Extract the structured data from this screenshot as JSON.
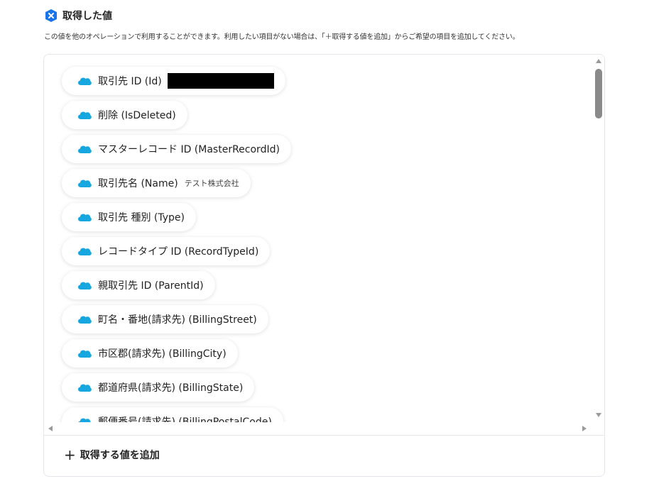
{
  "header": {
    "title": "取得した値"
  },
  "description": "この値を他のオペレーションで利用することができます。利用したい項目がない場合は、「＋取得する値を追加」からご希望の項目を追加してください。",
  "colors": {
    "brand_blue": "#1a73e8",
    "salesforce_cloud": "#16a6e0"
  },
  "items": [
    {
      "label": "取引先 ID (Id)",
      "value": "",
      "redacted": true
    },
    {
      "label": "削除 (IsDeleted)",
      "value": ""
    },
    {
      "label": "マスターレコード ID (MasterRecordId)",
      "value": ""
    },
    {
      "label": "取引先名 (Name)",
      "value": "テスト株式会社"
    },
    {
      "label": "取引先 種別 (Type)",
      "value": ""
    },
    {
      "label": "レコードタイプ ID (RecordTypeId)",
      "value": ""
    },
    {
      "label": "親取引先 ID (ParentId)",
      "value": ""
    },
    {
      "label": "町名・番地(請求先) (BillingStreet)",
      "value": ""
    },
    {
      "label": "市区郡(請求先) (BillingCity)",
      "value": ""
    },
    {
      "label": "都道府県(請求先) (BillingState)",
      "value": ""
    },
    {
      "label": "郵便番号(請求先) (BillingPostalCode)",
      "value": ""
    }
  ],
  "add_button": {
    "plus": "+",
    "label": "取得する値を追加"
  }
}
